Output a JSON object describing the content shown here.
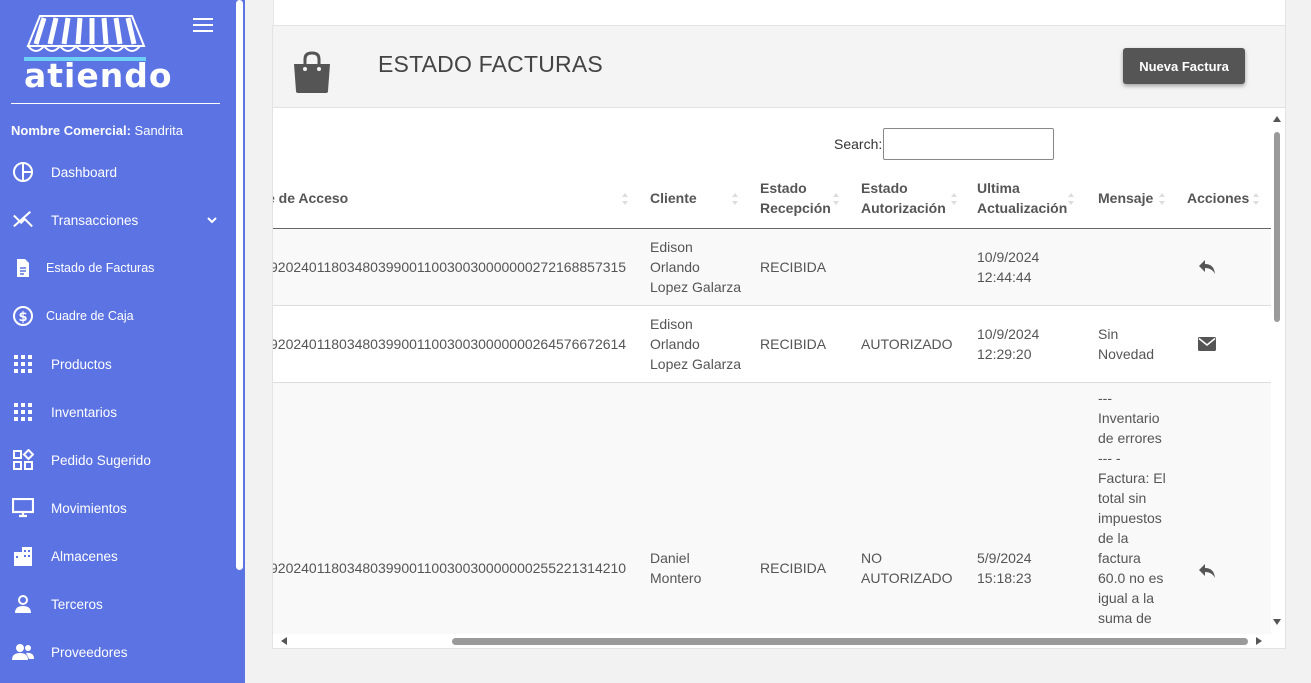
{
  "app": {
    "logo_text": "atiendo"
  },
  "sidebar": {
    "nombre_label": "Nombre Comercial:",
    "nombre_value": "Sandrita",
    "items": [
      {
        "label": "Dashboard",
        "icon": "dashboard-icon"
      },
      {
        "label": "Transacciones",
        "icon": "transactions-icon"
      },
      {
        "label": "Estado de Facturas",
        "icon": "document-icon"
      },
      {
        "label": "Cuadre de Caja",
        "icon": "dollar-icon"
      },
      {
        "label": "Productos",
        "icon": "grid-icon"
      },
      {
        "label": "Inventarios",
        "icon": "grid-icon"
      },
      {
        "label": "Pedido Sugerido",
        "icon": "widgets-icon"
      },
      {
        "label": "Movimientos",
        "icon": "monitor-icon"
      },
      {
        "label": "Almacenes",
        "icon": "building-icon"
      },
      {
        "label": "Terceros",
        "icon": "person-icon"
      },
      {
        "label": "Proveedores",
        "icon": "people-icon"
      }
    ]
  },
  "header": {
    "title": "ESTADO FACTURAS",
    "new_button": "Nueva Factura"
  },
  "search": {
    "label": "Search:",
    "value": ""
  },
  "table": {
    "columns": {
      "clave": "e de Acceso",
      "cliente": "Cliente",
      "recepcion_1": "Estado",
      "recepcion_2": "Recepción",
      "autorizacion_1": "Estado",
      "autorizacion_2": "Autorización",
      "actualizacion_1": "Ultima",
      "actualizacion_2": "Actualización",
      "mensaje": "Mensaje",
      "acciones": "Acciones"
    },
    "rows": [
      {
        "clave": "9202401180348039900110030030000000272168857315",
        "cliente": [
          "Edison",
          "Orlando",
          "Lopez Galarza"
        ],
        "recepcion": "RECIBIDA",
        "autorizacion": [
          "",
          ""
        ],
        "actualizacion": [
          "10/9/2024",
          "12:44:44"
        ],
        "mensaje": [
          "",
          ""
        ],
        "accion_icon": "reply-icon"
      },
      {
        "clave": "9202401180348039900110030030000000264576672614",
        "cliente": [
          "Edison",
          "Orlando",
          "Lopez Galarza"
        ],
        "recepcion": "RECIBIDA",
        "autorizacion": [
          "AUTORIZADO",
          ""
        ],
        "actualizacion": [
          "10/9/2024",
          "12:29:20"
        ],
        "mensaje": [
          "Sin",
          "Novedad"
        ],
        "accion_icon": "envelope-icon"
      },
      {
        "clave": "9202401180348039900110030030000000255221314210",
        "cliente": [
          "Daniel",
          "Montero"
        ],
        "recepcion": "RECIBIDA",
        "autorizacion": [
          "NO",
          "AUTORIZADO"
        ],
        "actualizacion": [
          "5/9/2024",
          "15:18:23"
        ],
        "mensaje": [
          "---",
          "Inventario",
          "de errores",
          "--- -",
          "Factura: El",
          "total sin",
          "impuestos",
          "de la",
          "factura",
          "60.0 no es",
          "igual a la",
          "suma de"
        ],
        "accion_icon": "reply-icon"
      }
    ]
  },
  "colors": {
    "sidebar": "#5c73e3",
    "button": "#555555"
  }
}
